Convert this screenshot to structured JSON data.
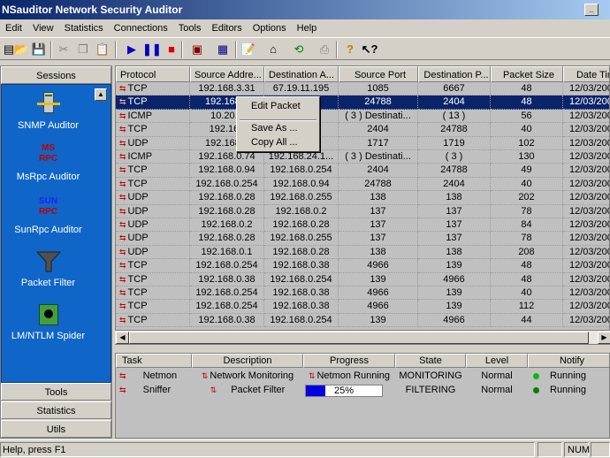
{
  "window": {
    "title": "NSauditor Network Security Auditor"
  },
  "menu": [
    "Edit",
    "View",
    "Statistics",
    "Connections",
    "Tools",
    "Editors",
    "Options",
    "Help"
  ],
  "sessions": {
    "header": "Sessions",
    "items": [
      {
        "label": "SNMP Auditor",
        "icon": "snmp-server-icon"
      },
      {
        "label": "MsRpc Auditor",
        "icon": "msrpc-icon",
        "icon_text_top": "MS",
        "icon_text_bottom": "RPC"
      },
      {
        "label": "SunRpc Auditor",
        "icon": "sunrpc-icon",
        "icon_text_top": "SUN",
        "icon_text_bottom": "RPC"
      },
      {
        "label": "Packet Filter",
        "icon": "funnel-icon"
      },
      {
        "label": "LM/NTLM Spider",
        "icon": "spider-icon"
      }
    ],
    "tabs": [
      "Tools",
      "Statistics",
      "Utils"
    ]
  },
  "packets": {
    "columns": [
      "Protocol",
      "Source Addre...",
      "Destination A...",
      "Source Port",
      "Destination P...",
      "Packet Size",
      "Date Tim"
    ],
    "selected_row": 1,
    "rows": [
      [
        "TCP",
        "192.168.3.31",
        "67.19.11.195",
        "1085",
        "6667",
        "48",
        "12/03/2004"
      ],
      [
        "TCP",
        "192.168.0",
        "84",
        "24788",
        "2404",
        "48",
        "12/03/2004"
      ],
      [
        "ICMP",
        "10.20.0",
        "31",
        "( 3 ) Destinati...",
        "( 13 )",
        "56",
        "12/03/2004"
      ],
      [
        "TCP",
        "192.168",
        "54",
        "2404",
        "24788",
        "40",
        "12/03/2004"
      ],
      [
        "UDP",
        "192.168.2",
        "74",
        "1717",
        "1719",
        "102",
        "12/03/2004"
      ],
      [
        "ICMP",
        "192.168.0.74",
        "192.168.24.1...",
        "( 3 ) Destinati...",
        "( 3 )",
        "130",
        "12/03/2004"
      ],
      [
        "TCP",
        "192.168.0.94",
        "192.168.0.254",
        "2404",
        "24788",
        "49",
        "12/03/2004"
      ],
      [
        "TCP",
        "192.168.0.254",
        "192.168.0.94",
        "24788",
        "2404",
        "40",
        "12/03/2004"
      ],
      [
        "UDP",
        "192.168.0.28",
        "192.168.0.255",
        "138",
        "138",
        "202",
        "12/03/2004"
      ],
      [
        "UDP",
        "192.168.0.28",
        "192.168.0.2",
        "137",
        "137",
        "78",
        "12/03/2004"
      ],
      [
        "UDP",
        "192.168.0.2",
        "192.168.0.28",
        "137",
        "137",
        "84",
        "12/03/2004"
      ],
      [
        "UDP",
        "192.168.0.28",
        "192.168.0.255",
        "137",
        "137",
        "78",
        "12/03/2004"
      ],
      [
        "UDP",
        "192.168.0.1",
        "192.168.0.28",
        "138",
        "138",
        "208",
        "12/03/2004"
      ],
      [
        "TCP",
        "192.168.0.254",
        "192.168.0.38",
        "4966",
        "139",
        "48",
        "12/03/2004"
      ],
      [
        "TCP",
        "192.168.0.38",
        "192.168.0.254",
        "139",
        "4966",
        "48",
        "12/03/2004"
      ],
      [
        "TCP",
        "192.168.0.254",
        "192.168.0.38",
        "4966",
        "139",
        "40",
        "12/03/2004"
      ],
      [
        "TCP",
        "192.168.0.254",
        "192.168.0.38",
        "4966",
        "139",
        "112",
        "12/03/2004"
      ],
      [
        "TCP",
        "192.168.0.38",
        "192.168.0.254",
        "139",
        "4966",
        "44",
        "12/03/2004"
      ]
    ]
  },
  "context_menu": {
    "items": [
      "Edit Packet",
      "Save As ...",
      "Copy All ..."
    ]
  },
  "tasks": {
    "columns": [
      "Task",
      "Description",
      "Progress",
      "State",
      "Level",
      "Notify"
    ],
    "rows": [
      {
        "task": "Netmon",
        "description": "Network Monitoring",
        "progress_text": "Netmon Running",
        "progress": null,
        "state": "MONITORING",
        "level": "Normal",
        "notify": "Running"
      },
      {
        "task": "Sniffer",
        "description": "Packet Filter",
        "progress_text": "25%",
        "progress": 0.25,
        "state": "FILTERING",
        "level": "Normal",
        "notify": "Running"
      }
    ]
  },
  "status": {
    "text": "Help, press F1",
    "num": "NUM"
  }
}
